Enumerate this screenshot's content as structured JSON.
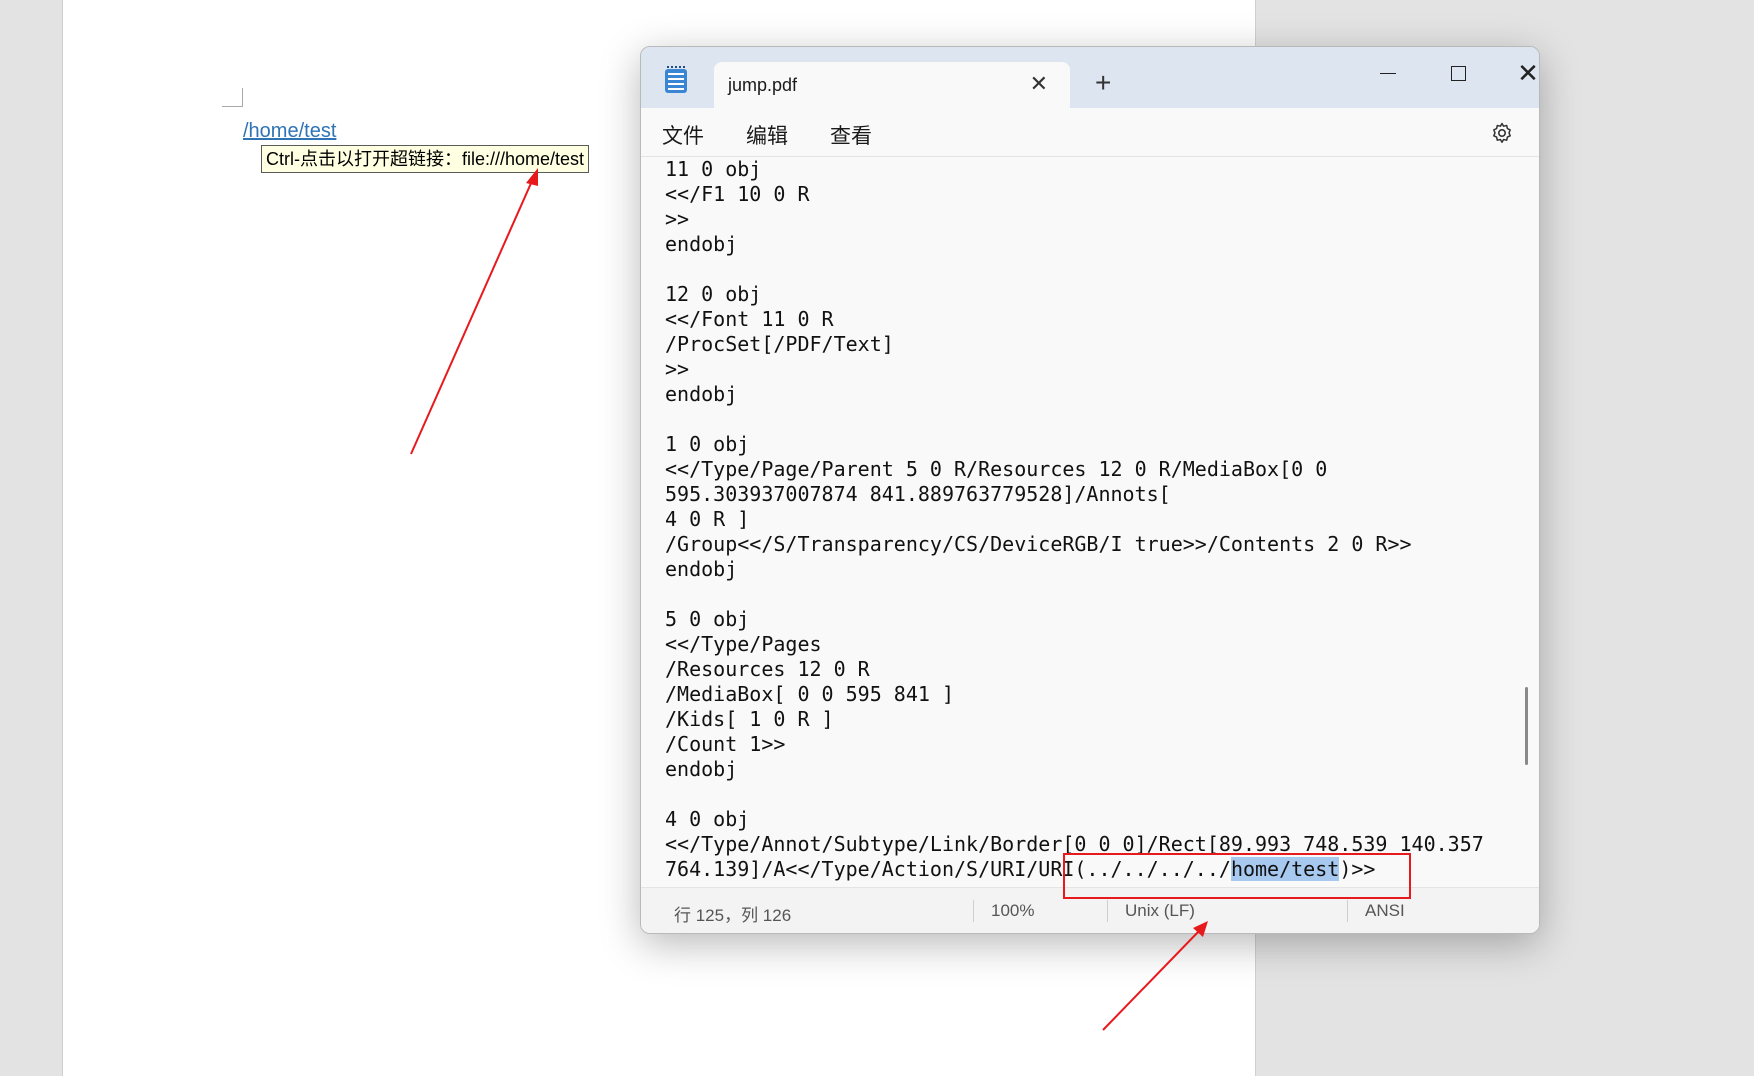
{
  "document": {
    "link_text": "/home/test",
    "tooltip": "Ctrl-点击以打开超链接：file:///home/test"
  },
  "window": {
    "tab_title": "jump.pdf",
    "new_tab_icon": "plus-icon",
    "menu": [
      "文件",
      "编辑",
      "查看"
    ],
    "settings_icon": "gear-icon"
  },
  "editor": {
    "lines": [
      "11 0 obj",
      "<</F1 10 0 R",
      ">>",
      "endobj",
      "",
      "12 0 obj",
      "<</Font 11 0 R",
      "/ProcSet[/PDF/Text]",
      ">>",
      "endobj",
      "",
      "1 0 obj",
      "<</Type/Page/Parent 5 0 R/Resources 12 0 R/MediaBox[0 0",
      "595.303937007874 841.889763779528]/Annots[",
      "4 0 R ]",
      "/Group<</S/Transparency/CS/DeviceRGB/I true>>/Contents 2 0 R>>",
      "endobj",
      "",
      "5 0 obj",
      "<</Type/Pages",
      "/Resources 12 0 R",
      "/MediaBox[ 0 0 595 841 ]",
      "/Kids[ 1 0 R ]",
      "/Count 1>>",
      "endobj",
      "",
      "4 0 obj",
      "<</Type/Annot/Subtype/Link/Border[0 0 0]/Rect[89.993 748.539 140.357"
    ],
    "last_line_prefix": "764.139]/A<</Type/Action/S/URI/URI(../../../../",
    "last_line_highlight": "home/test",
    "last_line_suffix": ")>>"
  },
  "status": {
    "position": "行 125，列 126",
    "zoom": "100%",
    "line_ending": "Unix (LF)",
    "encoding": "ANSI"
  },
  "annotation_colors": {
    "arrow": "#e8191c",
    "box": "#e8191c",
    "selection": "#a8c9ef"
  }
}
